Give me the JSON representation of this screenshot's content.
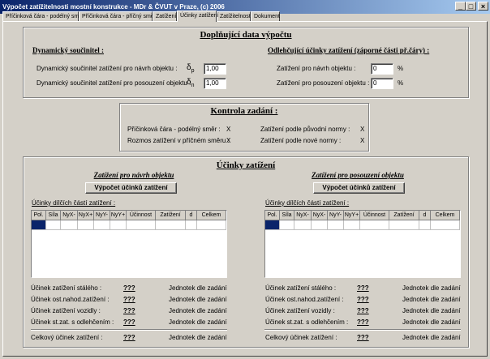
{
  "window": {
    "title": "Výpočet zatížitelnosti mostní konstrukce  -  MDr & ČVUT v Praze, (c) 2006",
    "buttons": {
      "minimize": "_",
      "maximize": "□",
      "close": "×"
    }
  },
  "tabs": [
    "Příčinková čára - podélný směr",
    "Příčinková čára - příčný směr",
    "Zatížení",
    "Účinky zatížení",
    "Zatížitelnost",
    "Dokument"
  ],
  "active_tab": "Účinky zatížení",
  "additional": {
    "title": "Doplňující data výpočtu",
    "dynamic_title": "Dynamický součinitel :",
    "dyn_design_label": "Dynamický součinitel zatížení pro návrh objektu :",
    "dyn_design_symbol": "δp",
    "dyn_design_sym_main": "δ",
    "dyn_design_sym_sub": "p",
    "dyn_design_value": "1,00",
    "dyn_assess_label": "Dynamický součinitel zatížení pro posouzení objektu :",
    "dyn_assess_sym_main": "δ",
    "dyn_assess_sym_sub": "n",
    "dyn_assess_value": "1,00",
    "relief_title": "Odlehčující účinky zatížení (záporné části př.čáry) :",
    "relief_design_label": "Zatížení pro návrh objektu :",
    "relief_design_value": "0",
    "relief_assess_label": "Zatížení pro posouzení objektu :",
    "relief_assess_value": "0",
    "unit": "%"
  },
  "check": {
    "title": "Kontrola zadání :",
    "items": [
      {
        "label": "Příčinková čára - podélný směr :",
        "value": "X"
      },
      {
        "label": "Zatížení podle původní normy :",
        "value": "X"
      },
      {
        "label": "Rozmos zatížení v příčném směru :",
        "value": "X"
      },
      {
        "label": "Zatížení podle nové normy :",
        "value": "X"
      }
    ]
  },
  "effects": {
    "title": "Účinky zatížení",
    "left": {
      "subtitle": "Zatížení pro návrh objektu",
      "button": "Výpočet účinků zatížení",
      "grid_label": "Účinky dílčích částí zatížení :",
      "columns": [
        "Pol.",
        "Síla",
        "NyX-",
        "NyX+",
        "NyY-",
        "NyY+",
        "Účinnost",
        "Zatížení",
        "d",
        "Celkem"
      ]
    },
    "right": {
      "subtitle": "Zatížení pro posouzení objektu",
      "button": "Výpočet účinků zatížení",
      "grid_label": "Účinky dílčích částí zatížení :",
      "columns": [
        "Pol.",
        "Síla",
        "NyX-",
        "NyX-",
        "NyY-",
        "NyY+",
        "Účinnost",
        "Zatížení",
        "d",
        "Celkem"
      ]
    },
    "summary_labels": [
      "Účinek zatížení stálého :",
      "Účinek ost.nahod.zatížení :",
      "Účinek zatížení vozidly :",
      "Účinek st.zat. s odlehčením :"
    ],
    "total_label": "Celkový účinek zatížení :",
    "value": "???",
    "unit_text": "Jednotek dle zadání"
  }
}
